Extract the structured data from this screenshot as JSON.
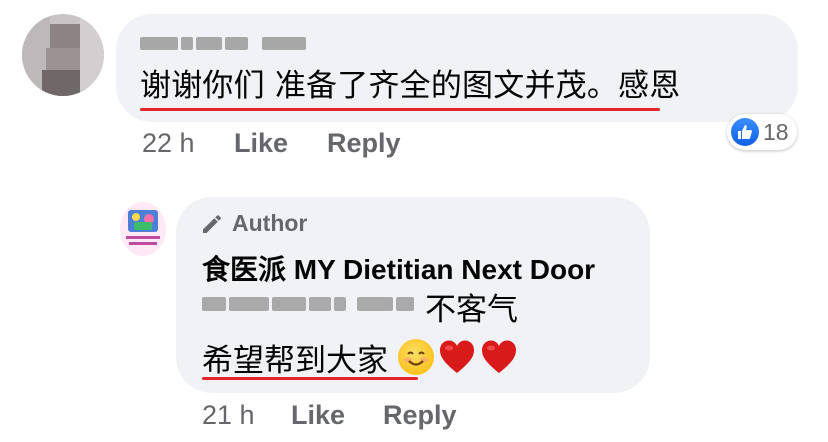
{
  "comment1": {
    "text": "谢谢你们 准备了齐全的图文并茂。感恩",
    "time": "22 h",
    "like_label": "Like",
    "reply_label": "Reply",
    "reaction_count": "18"
  },
  "reply": {
    "author_badge": "Author",
    "page_name": "食医派 MY Dietitian Next Door",
    "line1_text": "不客气",
    "line2_text": "希望帮到大家",
    "time": "21 h",
    "like_label": "Like",
    "reply_label": "Reply"
  },
  "icons": [
    "blurred-avatar",
    "like-icon",
    "pencil-icon",
    "page-logo",
    "smiling-face-emoji",
    "red-heart-emoji"
  ],
  "colors": {
    "bubble": "#f0f2f5",
    "meta_text": "#65676b",
    "like_blue": "#1877f2",
    "underline_red": "#e3262b",
    "heart_red": "#d91a1a"
  }
}
